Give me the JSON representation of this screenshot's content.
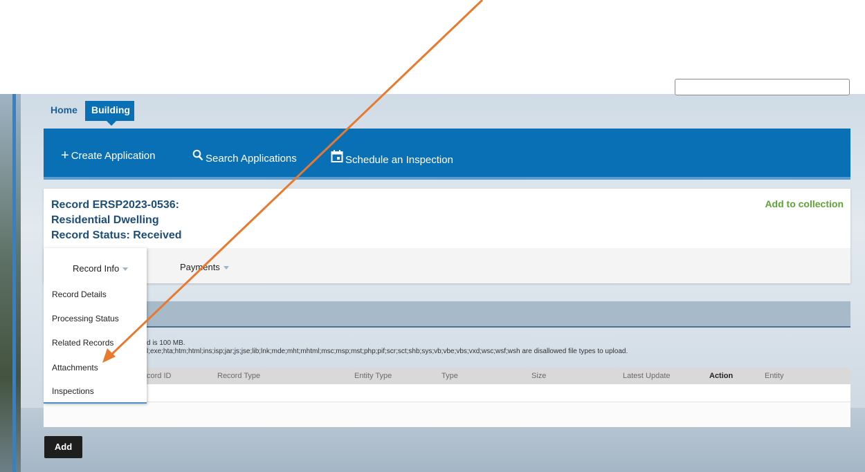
{
  "nav": {
    "home": "Home",
    "building": "Building"
  },
  "actions": {
    "create": "Create Application",
    "search": "Search Applications",
    "schedule": "Schedule an Inspection"
  },
  "record": {
    "line1": "Record ERSP2023-0536:",
    "line2": "Residential Dwelling",
    "line3": "Record Status: Received",
    "add_to_collection": "Add to collection"
  },
  "record_tabs": {
    "record_info": "Record Info",
    "payments": "Payments"
  },
  "dropdown_items": [
    "Record Details",
    "Processing Status",
    "Related Records",
    "Attachments",
    "Inspections"
  ],
  "attachments": {
    "upload_limit": "d is 100 MB.",
    "disallowed": "l;exe;hta;htm;html;ins;isp;jar;js;jse;lib;lnk;mde;mht;mhtml;msc;msp;mst;php;pif;scr;sct;shb;sys;vb;vbe;vbs;vxd;wsc;wsf;wsh are disallowed file types to upload."
  },
  "table_columns": [
    "cord ID",
    "Record Type",
    "Entity Type",
    "Type",
    "Size",
    "Latest Update",
    "Action",
    "Entity"
  ],
  "add_button": "Add",
  "colors": {
    "brand_blue": "#0a70b5",
    "record_title": "#1d4d79",
    "collection_green": "#5fa336",
    "annotation_arrow": "#e8792e"
  },
  "icons": {
    "create": "plus-icon",
    "search": "magnifier-icon",
    "schedule": "calendar-icon"
  }
}
